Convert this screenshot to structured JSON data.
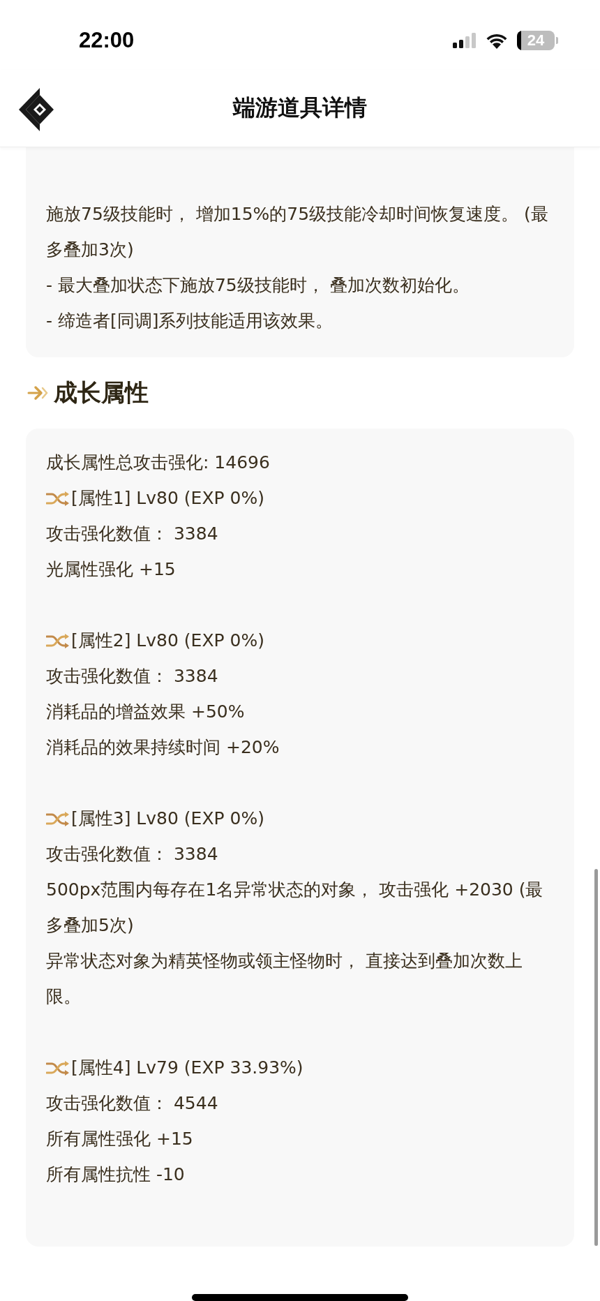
{
  "status_bar": {
    "time": "22:00",
    "battery": "24"
  },
  "header": {
    "title": "端游道具详情"
  },
  "effect_card": {
    "lines": [
      "施放75级技能时， 增加15%的75级技能冷却时间恢复速度。 (最多叠加3次)",
      "- 最大叠加状态下施放75级技能时， 叠加次数初始化。",
      "- 缔造者[同调]系列技能适用该效果。"
    ]
  },
  "growth_section": {
    "title": "成长属性",
    "total": "成长属性总攻击强化: 14696",
    "attributes": [
      {
        "heading": "[属性1] Lv80 (EXP 0%)",
        "lines": [
          "攻击强化数值： 3384",
          "光属性强化 +15"
        ]
      },
      {
        "heading": "[属性2] Lv80 (EXP 0%)",
        "lines": [
          "攻击强化数值： 3384",
          "消耗品的增益效果 +50%",
          "消耗品的效果持续时间 +20%"
        ]
      },
      {
        "heading": "[属性3] Lv80 (EXP 0%)",
        "lines": [
          "攻击强化数值： 3384",
          "500px范围内每存在1名异常状态的对象， 攻击强化 +2030 (最多叠加5次)",
          "异常状态对象为精英怪物或领主怪物时， 直接达到叠加次数上限。"
        ]
      },
      {
        "heading": "[属性4] Lv79 (EXP 33.93%)",
        "lines": [
          "攻击强化数值： 4544",
          "所有属性强化 +15",
          "所有属性抗性 -10"
        ]
      }
    ]
  }
}
